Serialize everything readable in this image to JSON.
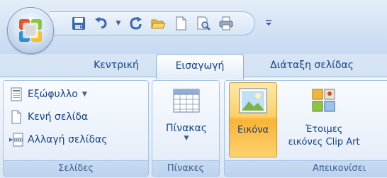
{
  "quick_access": {
    "buttons": [
      "save-icon",
      "undo-icon",
      "redo-icon",
      "open-folder-icon",
      "new-document-icon",
      "print-preview-icon",
      "print-icon"
    ]
  },
  "tabs": [
    {
      "label": "Κεντρική"
    },
    {
      "label": "Εισαγωγή",
      "active": true
    },
    {
      "label": "Διάταξη σελίδας"
    }
  ],
  "groups": {
    "pages": {
      "label": "Σελίδες",
      "items": [
        {
          "label": "Εξώφυλλο",
          "has_dropdown": true
        },
        {
          "label": "Κενή σελίδα"
        },
        {
          "label": "Αλλαγή σελίδας"
        }
      ]
    },
    "tables": {
      "label": "Πίνακες",
      "button_label": "Πίνακας"
    },
    "illustrations": {
      "label": "Απεικονίσει",
      "picture_label": "Εικόνα",
      "clipart_label_line1": "Έτοιμες",
      "clipart_label_line2": "εικόνες Clip Art"
    }
  },
  "colors": {
    "tab_text": "#15428b",
    "ribbon_border": "#8db2e3",
    "highlight": "#fcd06a"
  }
}
